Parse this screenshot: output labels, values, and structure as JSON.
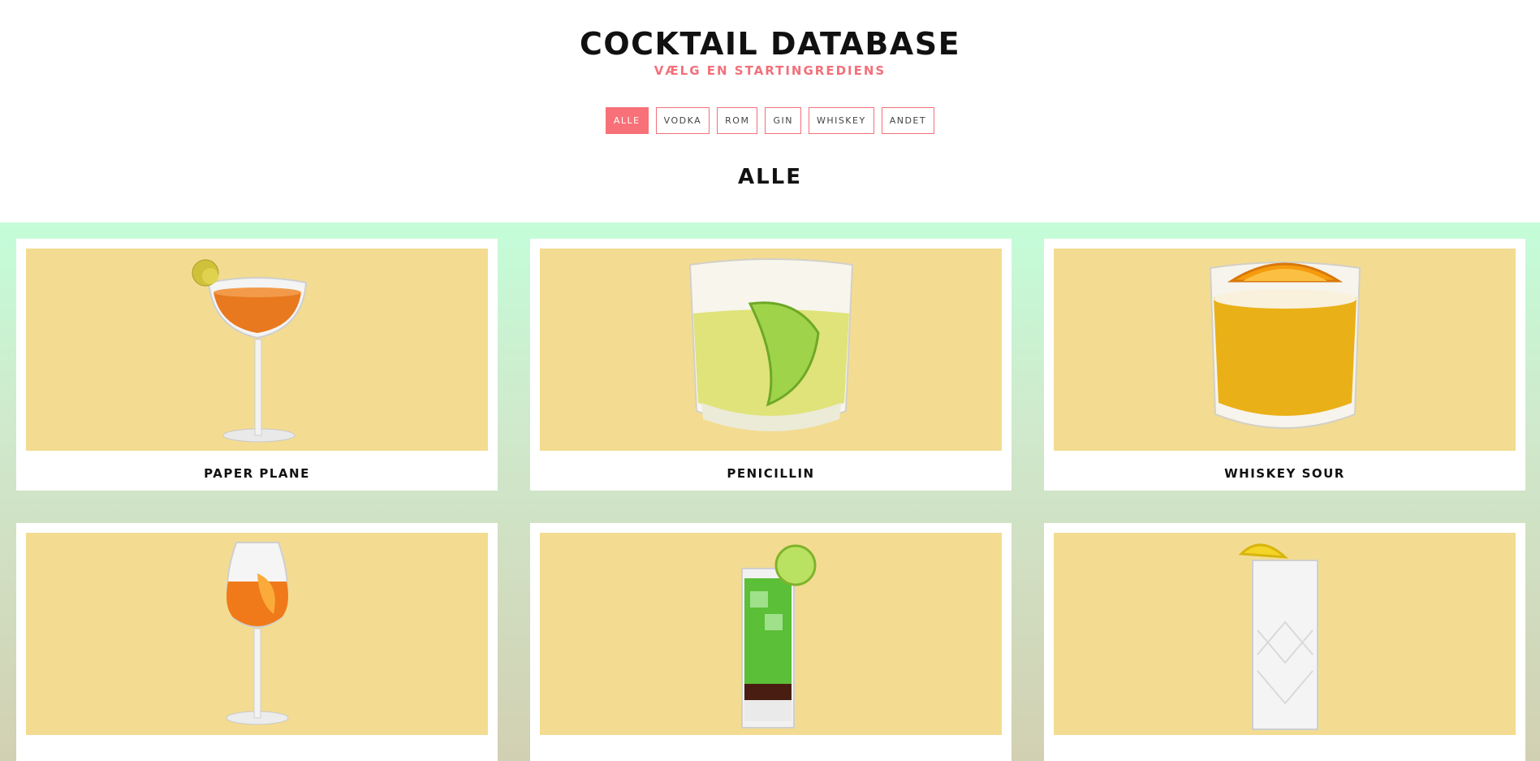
{
  "header": {
    "title": "COCKTAIL DATABASE",
    "subtitle": "VÆLG EN STARTINGREDIENS"
  },
  "filters": [
    {
      "label": "ALLE",
      "active": true
    },
    {
      "label": "VODKA",
      "active": false
    },
    {
      "label": "ROM",
      "active": false
    },
    {
      "label": "GIN",
      "active": false
    },
    {
      "label": "WHISKEY",
      "active": false
    },
    {
      "label": "ANDET",
      "active": false
    }
  ],
  "section": {
    "heading": "ALLE"
  },
  "colors": {
    "accent": "#f87178",
    "card_image_bg": "#f3dc91",
    "gradient_top": "#c4fdd9",
    "gradient_bottom": "#d2d0b2"
  },
  "cocktails": [
    {
      "name": "PAPER PLANE",
      "image": "coupe-glass-orange-drink"
    },
    {
      "name": "PENICILLIN",
      "image": "rocks-glass-yellow-drink-lime"
    },
    {
      "name": "WHISKEY SOUR",
      "image": "rocks-glass-orange-drink-orange-slice"
    },
    {
      "name": "",
      "image": "wine-glass-spritz-orange"
    },
    {
      "name": "",
      "image": "highball-green-layered-lime"
    },
    {
      "name": "",
      "image": "crystal-highball-clear-lemon"
    }
  ]
}
